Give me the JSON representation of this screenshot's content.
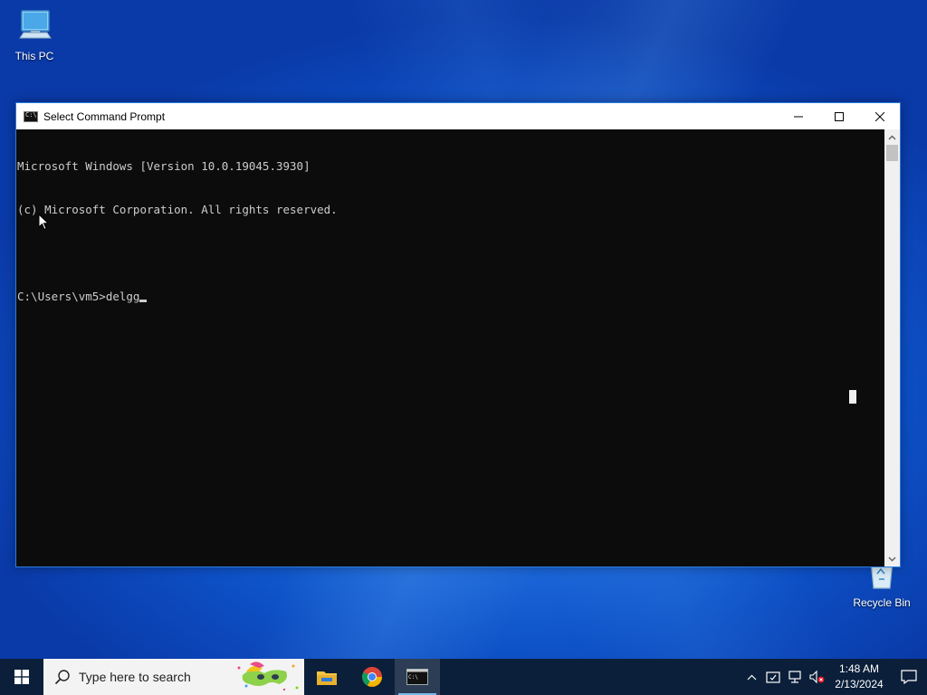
{
  "desktop": {
    "icons": [
      {
        "label": "This PC"
      },
      {
        "label": "Recycle Bin"
      }
    ]
  },
  "window": {
    "title": "Select Command Prompt",
    "controls": {
      "minimize": "minimize-icon",
      "maximize": "maximize-icon",
      "close": "close-icon"
    },
    "console": {
      "lines": [
        "Microsoft Windows [Version 10.0.19045.3930]",
        "(c) Microsoft Corporation. All rights reserved.",
        "",
        "C:\\Users\\vm5>delgg"
      ]
    }
  },
  "taskbar": {
    "search_placeholder": "Type here to search",
    "apps": [
      "file-explorer-icon",
      "chrome-icon",
      "command-prompt-icon"
    ],
    "clock": {
      "time": "1:48 AM",
      "date": "2/13/2024"
    }
  },
  "colors": {
    "console_bg": "#0c0c0c",
    "console_text": "#cccccc",
    "taskbar_bg": "#0b1f3a",
    "window_border": "#2b7de0"
  }
}
